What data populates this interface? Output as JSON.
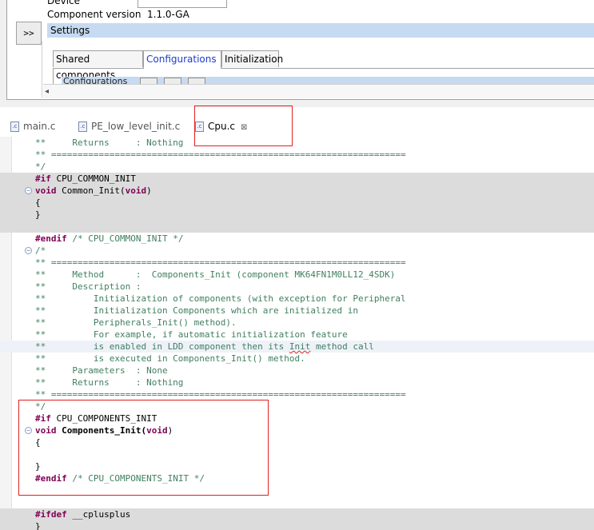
{
  "properties": {
    "device_label": "Device",
    "component_version_label": "Component version",
    "component_version_value": "1.1.0-GA",
    "expand_label": ">>",
    "settings_label": "Settings",
    "tabs": [
      {
        "label": "Shared components"
      },
      {
        "label": "Configurations"
      },
      {
        "label": "Initialization"
      }
    ],
    "configurations_label": "Configurations",
    "scroll_left": "◂"
  },
  "editor": {
    "tabs": [
      {
        "label": "main.c",
        "icon": ".c"
      },
      {
        "label": "PE_low_level_init.c",
        "icon": ".c"
      },
      {
        "label": "Cpu.c",
        "icon": ".c",
        "close": "⊠"
      }
    ]
  },
  "code": {
    "l0": "**     Returns     : Nothing",
    "l1": "** ===================================================================",
    "l2": "*/",
    "l3a": "#if",
    "l3b": " CPU_COMMON_INIT",
    "l4a": "void",
    "l4b": " Common_Init(",
    "l4c": "void",
    "l4d": ")",
    "l5": "{",
    "l6": "}",
    "l7": "",
    "l8a": "#endif",
    "l8b": " /* CPU_COMMON_INIT */",
    "l9": "/*",
    "l10": "** ===================================================================",
    "l11": "**     Method      :  Components_Init (component MK64FN1M0LL12_4SDK)",
    "l12": "**     Description :",
    "l13": "**         Initialization of components (with exception for Peripheral",
    "l14": "**         Initialization Components which are initialized in",
    "l15": "**         Peripherals_Init() method).",
    "l16": "**         For example, if automatic initialization feature",
    "l17a": "**         is enabled in LDD component then its ",
    "l17b": "Init",
    "l17c": " method call",
    "l18": "**         is executed in Components_Init() method.",
    "l19": "**     Parameters  : None",
    "l20": "**     Returns     : Nothing",
    "l21": "** ===================================================================",
    "l22": "*/",
    "l23a": "#if",
    "l23b": " CPU_COMPONENTS_INIT",
    "l24a": "void",
    "l24b": " Components_Init(",
    "l24c": "void",
    "l24d": ")",
    "l25": "{",
    "l26": "",
    "l27": "}",
    "l28a": "#endif",
    "l28b": " /* CPU_COMPONENTS_INIT */",
    "l29": "",
    "l30": "",
    "l31a": "#ifdef",
    "l31b": " __cplusplus",
    "l32": "}"
  },
  "colors": {
    "keyword": "#7f0055",
    "comment": "#3f7f5f",
    "inactive_highlight": "#dcdcdc",
    "annotation": "#e0211f"
  }
}
